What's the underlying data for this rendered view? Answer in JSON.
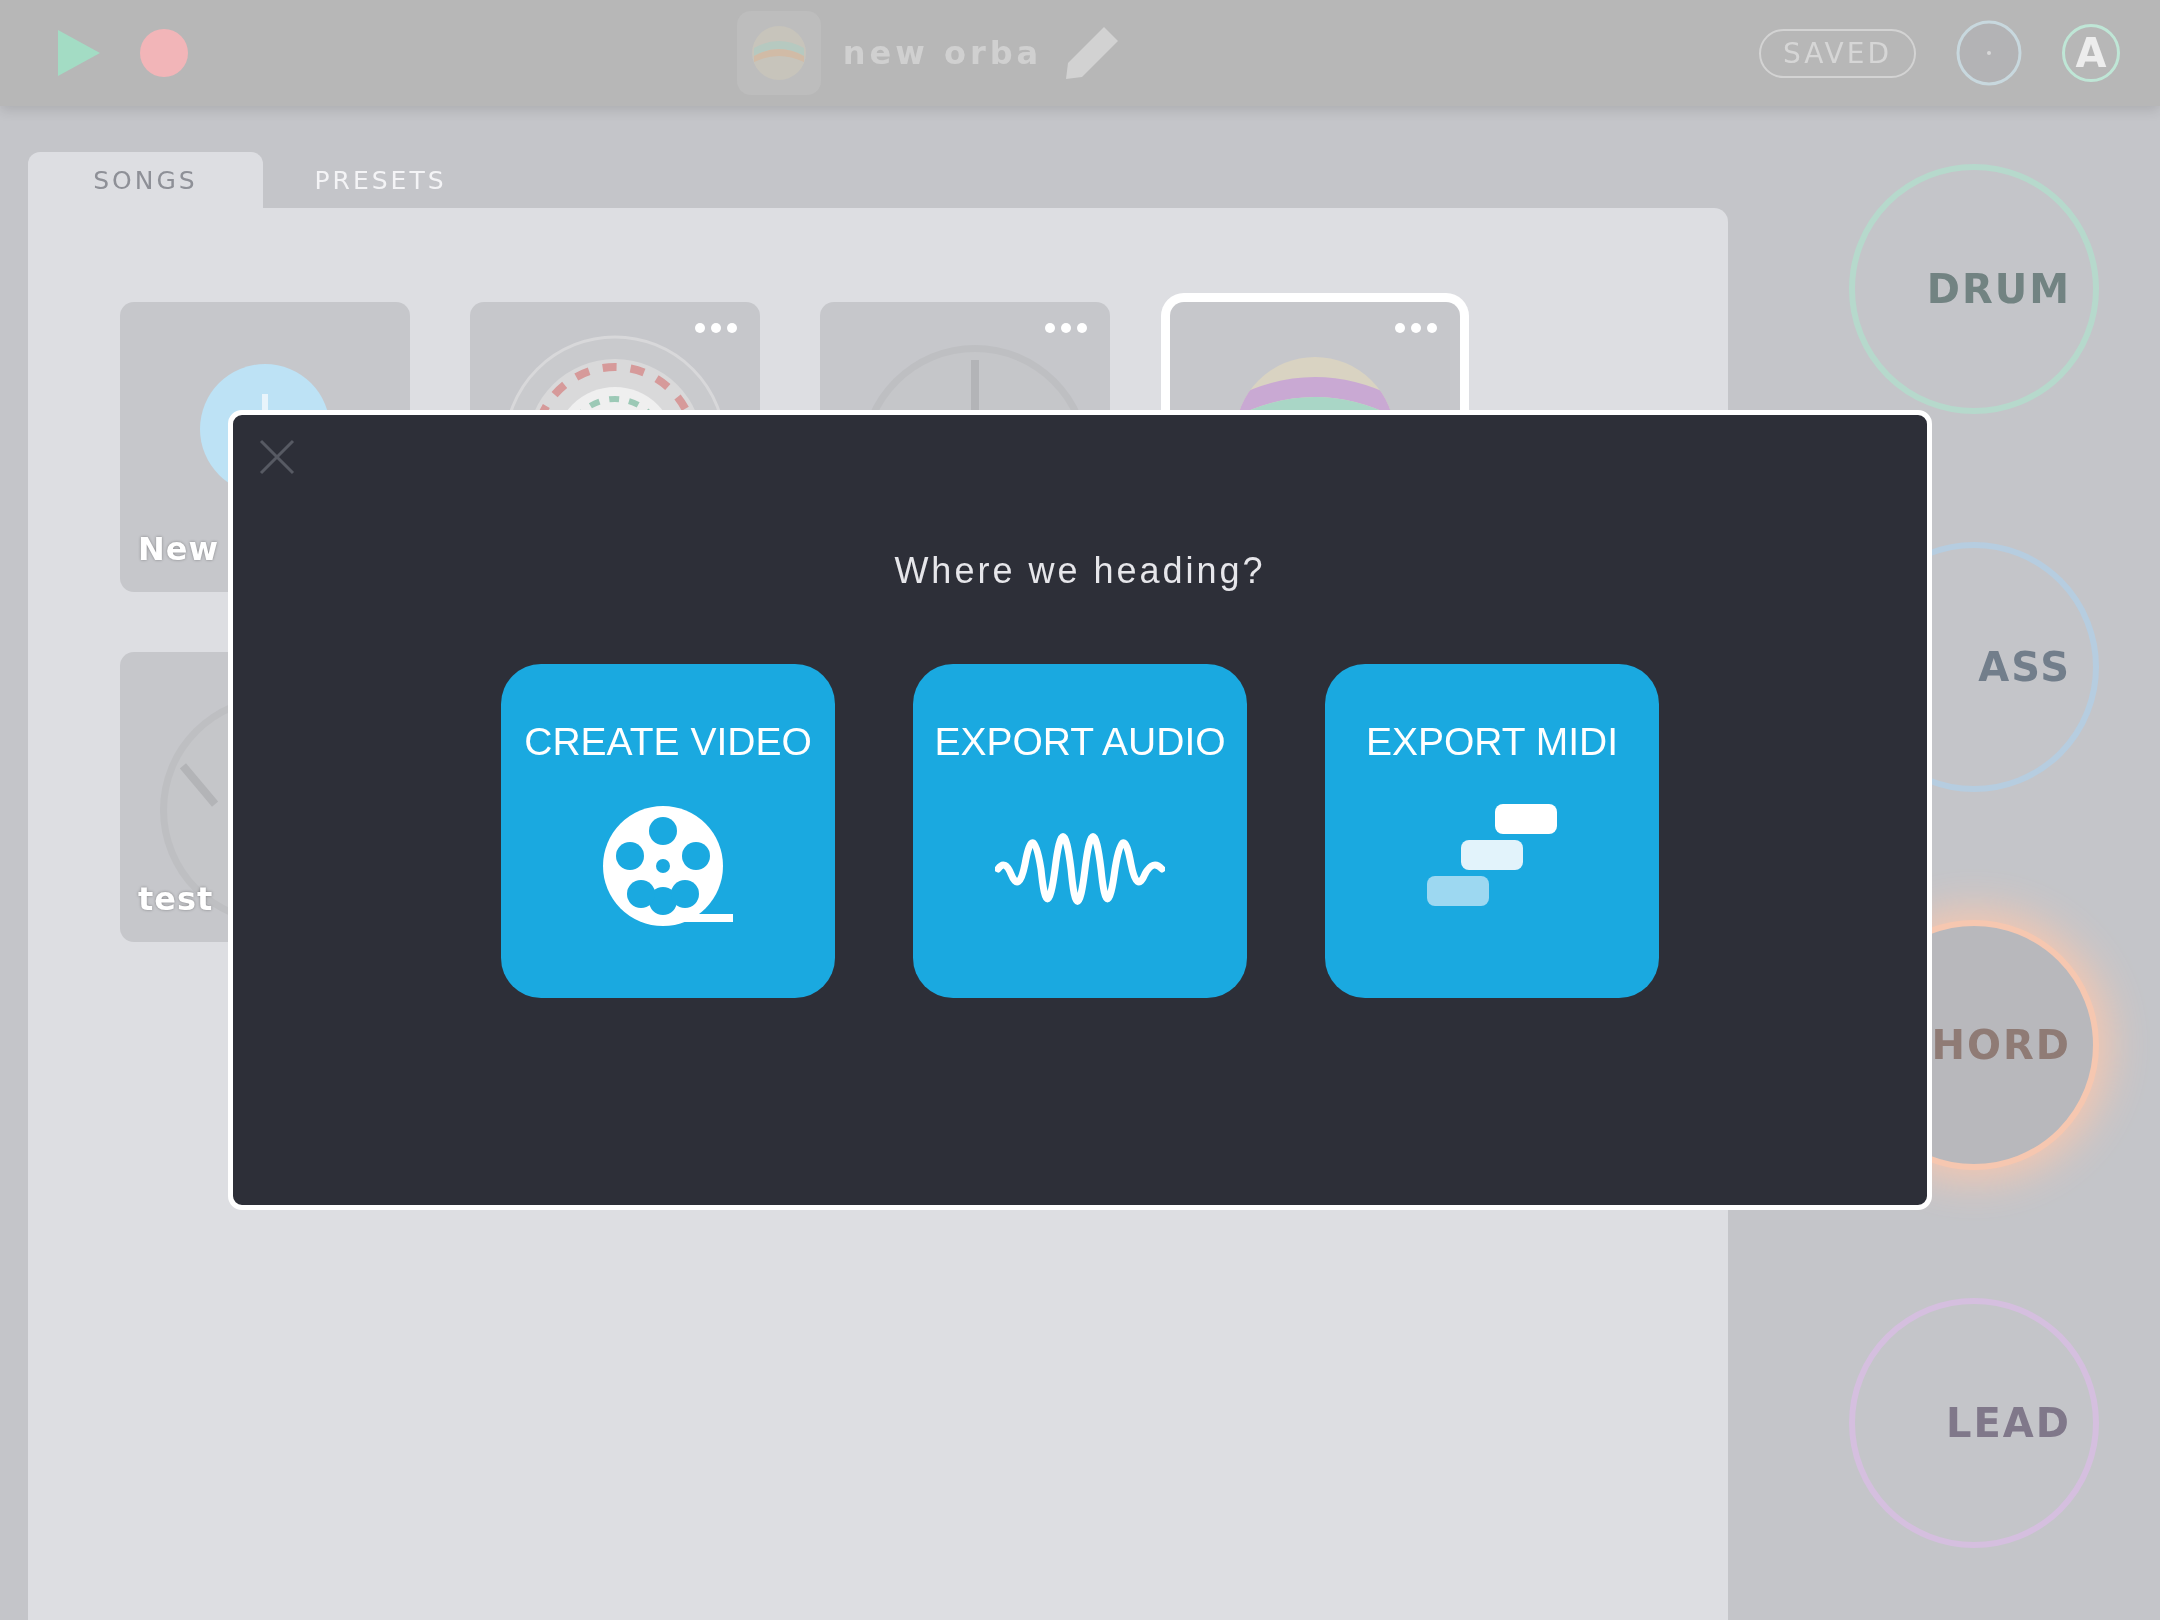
{
  "toolbar": {
    "title": "new orba",
    "status": "SAVED",
    "avatar": "A"
  },
  "tabs": [
    {
      "label": "SONGS",
      "selected": true
    },
    {
      "label": "PRESETS",
      "selected": false
    }
  ],
  "songs": [
    {
      "kind": "new",
      "title": "New",
      "selected": false
    },
    {
      "kind": "song",
      "selected": false
    },
    {
      "kind": "song",
      "selected": false
    },
    {
      "kind": "song",
      "selected": true
    },
    {
      "kind": "song",
      "title": "test",
      "selected": false
    }
  ],
  "instruments": [
    {
      "label": "DRUM",
      "color": "#b6d9cc",
      "active": false
    },
    {
      "label": "ASS",
      "color": "#b6cde0",
      "active": false
    },
    {
      "label": "HORD",
      "color": "#f6c7b0",
      "active": true
    },
    {
      "label": "LEAD",
      "color": "#d5bfdf",
      "active": false
    }
  ],
  "dialog": {
    "title": "Where we heading?",
    "options": [
      {
        "kind": "video",
        "label": "CREATE VIDEO"
      },
      {
        "kind": "audio",
        "label": "EXPORT AUDIO"
      },
      {
        "kind": "midi",
        "label": "EXPORT MIDI"
      }
    ]
  }
}
